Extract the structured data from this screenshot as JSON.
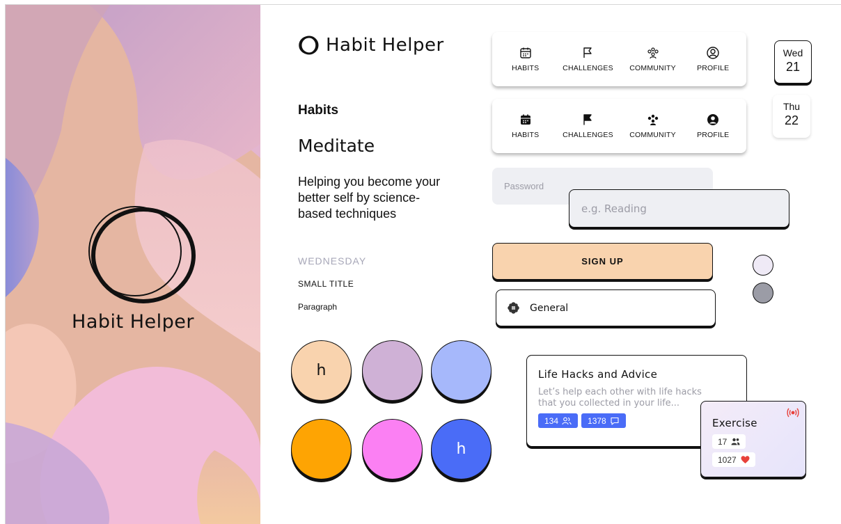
{
  "brand": {
    "name": "Habit Helper"
  },
  "splash": {
    "title": "Habit Helper"
  },
  "typography": {
    "heading": "Habits",
    "subheading": "Meditate",
    "lead": "Helping you become your better self by science-based techniques",
    "day": "WEDNESDAY",
    "small_title": "SMALL TITLE",
    "paragraph": "Paragraph"
  },
  "nav_outline": {
    "items": [
      {
        "label": "HABITS",
        "icon": "calendar-icon"
      },
      {
        "label": "CHALLENGES",
        "icon": "flag-icon"
      },
      {
        "label": "COMMUNITY",
        "icon": "community-icon"
      },
      {
        "label": "PROFILE",
        "icon": "profile-icon"
      }
    ]
  },
  "nav_filled": {
    "items": [
      {
        "label": "HABITS",
        "icon": "calendar-icon"
      },
      {
        "label": "CHALLENGES",
        "icon": "flag-icon"
      },
      {
        "label": "COMMUNITY",
        "icon": "community-icon"
      },
      {
        "label": "PROFILE",
        "icon": "profile-icon"
      }
    ]
  },
  "dates": [
    {
      "day": "Wed",
      "num": "21",
      "selected": true
    },
    {
      "day": "Thu",
      "num": "22",
      "selected": false
    }
  ],
  "form": {
    "password_placeholder": "Password",
    "habit_placeholder": "e.g. Reading",
    "signup_label": "SIGN UP",
    "category_label": "General"
  },
  "swatches": [
    {
      "color": "#f9d3ae",
      "label": "h",
      "text_color": "#111111"
    },
    {
      "color": "#cfb1d6",
      "label": ""
    },
    {
      "color": "#a6b8fb",
      "label": ""
    },
    {
      "color": "#fea403",
      "label": ""
    },
    {
      "color": "#fb80f3",
      "label": ""
    },
    {
      "color": "#4a6cf7",
      "label": "h",
      "text_color": "#ffffff"
    }
  ],
  "community_card": {
    "title": "Life Hacks and Advice",
    "description_line1": "Let’s help each other with life hacks",
    "description_line2": "that you collected in your life...",
    "members": "134",
    "comments": "1378"
  },
  "exercise_card": {
    "title": "Exercise",
    "participants": "17",
    "likes": "1027"
  },
  "colors": {
    "accent_blue": "#4a6cf7",
    "peach": "#f9d3ae",
    "input_bg": "#eeeff3",
    "live_red": "#e8413b"
  }
}
